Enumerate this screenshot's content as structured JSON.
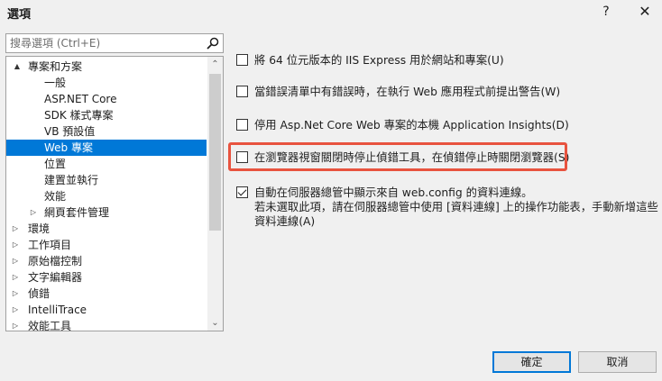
{
  "window": {
    "title": "選項",
    "help_label": "?",
    "close_label": "✕"
  },
  "search": {
    "placeholder": "搜尋選項 (Ctrl+E)"
  },
  "tree": {
    "items": [
      {
        "label": "專案和方案",
        "level": 0,
        "arrow": "▲",
        "selected": false
      },
      {
        "label": "一般",
        "level": 2,
        "arrow": "",
        "selected": false
      },
      {
        "label": "ASP.NET Core",
        "level": 2,
        "arrow": "",
        "selected": false
      },
      {
        "label": "SDK 樣式專案",
        "level": 2,
        "arrow": "",
        "selected": false
      },
      {
        "label": "VB 預設值",
        "level": 2,
        "arrow": "",
        "selected": false
      },
      {
        "label": "Web 專案",
        "level": 2,
        "arrow": "",
        "selected": true
      },
      {
        "label": "位置",
        "level": 2,
        "arrow": "",
        "selected": false
      },
      {
        "label": "建置並執行",
        "level": 2,
        "arrow": "",
        "selected": false
      },
      {
        "label": "效能",
        "level": 2,
        "arrow": "",
        "selected": false
      },
      {
        "label": "網頁套件管理",
        "level": 1,
        "arrow": "▷",
        "selected": false
      },
      {
        "label": "環境",
        "level": 0,
        "arrow": "▷",
        "selected": false
      },
      {
        "label": "工作項目",
        "level": 0,
        "arrow": "▷",
        "selected": false
      },
      {
        "label": "原始檔控制",
        "level": 0,
        "arrow": "▷",
        "selected": false
      },
      {
        "label": "文字編輯器",
        "level": 0,
        "arrow": "▷",
        "selected": false
      },
      {
        "label": "偵錯",
        "level": 0,
        "arrow": "▷",
        "selected": false
      },
      {
        "label": "IntelliTrace",
        "level": 0,
        "arrow": "▷",
        "selected": false
      },
      {
        "label": "效能工具",
        "level": 0,
        "arrow": "▷",
        "selected": false
      }
    ]
  },
  "options": [
    {
      "label": "將 64 位元版本的 IIS Express 用於網站和專案(U)",
      "checked": false
    },
    {
      "label": "當錯誤清單中有錯誤時，在執行 Web 應用程式前提出警告(W)",
      "checked": false
    },
    {
      "label": "停用 Asp.Net Core Web 專案的本機 Application Insights(D)",
      "checked": false
    },
    {
      "label": "在瀏覽器視窗關閉時停止偵錯工具，在偵錯停止時關閉瀏覽器(S)",
      "checked": false
    },
    {
      "label": "自動在伺服器總管中顯示來自 web.config 的資料連線。",
      "checked": true
    }
  ],
  "option5_extra": [
    "若未選取此項，請在伺服器總管中使用 [資料連線] 上的操作功能表，手動新增這些",
    "資料連線(A)"
  ],
  "buttons": {
    "ok_label": "確定",
    "cancel_label": "取消"
  },
  "colors": {
    "selection": "#0078d7",
    "highlight_border": "#e8533f"
  }
}
